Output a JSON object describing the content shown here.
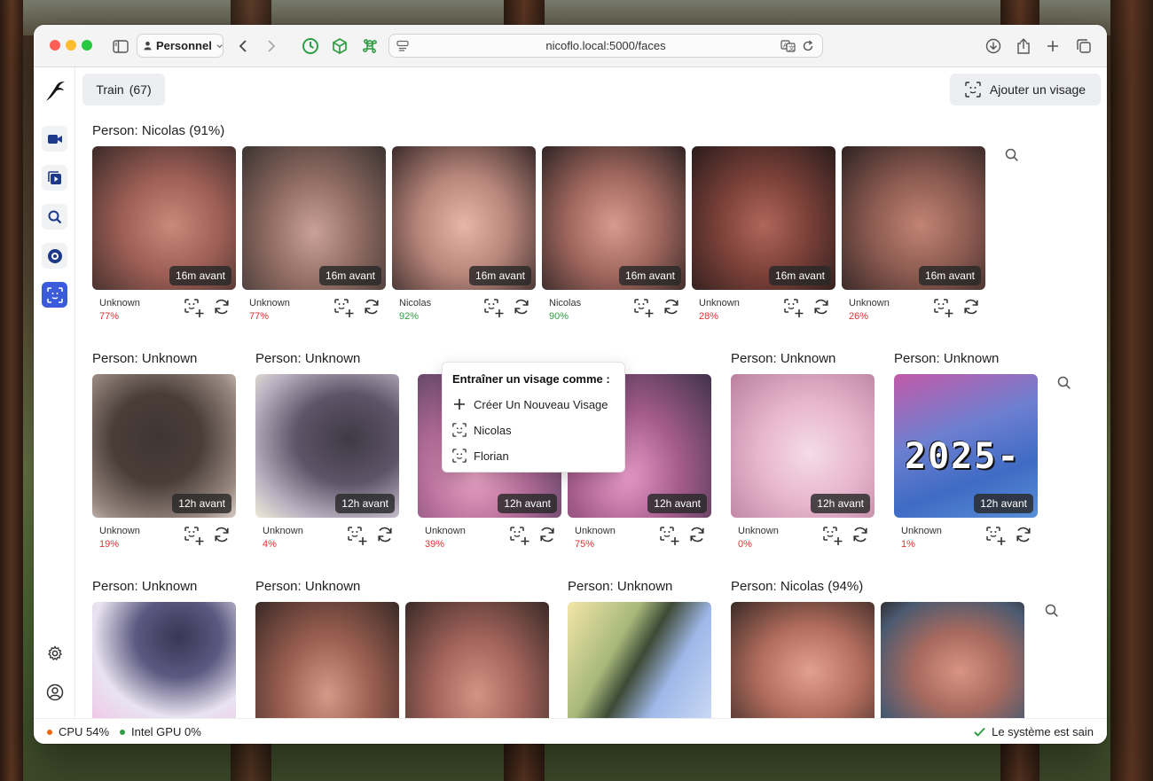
{
  "colors": {
    "accent": "#3b5bdb",
    "unknown_red": "#e03131",
    "known_green": "#2f9e44",
    "cpu_dot": "#f76707",
    "gpu_dot": "#2f9e44"
  },
  "browser": {
    "profile": "Personnel",
    "url": "nicoflo.local:5000/faces"
  },
  "sidebar": {
    "items": [
      {
        "name": "camera-icon"
      },
      {
        "name": "playback-icon"
      },
      {
        "name": "search-icon"
      },
      {
        "name": "target-icon"
      },
      {
        "name": "face-scan-icon"
      }
    ],
    "bottom": [
      {
        "name": "gear-icon"
      },
      {
        "name": "user-icon"
      }
    ]
  },
  "toolbar": {
    "train_label": "Train",
    "train_count": "(67)",
    "add_face_label": "Ajouter un visage"
  },
  "groups": [
    {
      "title": "Person: Nicolas (91%)"
    },
    {
      "title": "Person: Unknown"
    },
    {
      "title": "Person: Unknown"
    },
    {
      "title": "Person: Unknown"
    },
    {
      "title": "Person: Unknown"
    },
    {
      "title": "Person: Unknown"
    },
    {
      "title": "Person: Unknown"
    },
    {
      "title": "Person: Unknown"
    },
    {
      "title": "Person: Unknown"
    },
    {
      "title": "Person: Nicolas (94%)"
    }
  ],
  "faces_row1": [
    {
      "ago": "16m avant",
      "name": "Unknown",
      "pct": "77%"
    },
    {
      "ago": "16m avant",
      "name": "Unknown",
      "pct": "77%"
    },
    {
      "ago": "16m avant",
      "name": "Nicolas",
      "pct": "92%"
    },
    {
      "ago": "16m avant",
      "name": "Nicolas",
      "pct": "90%"
    },
    {
      "ago": "16m avant",
      "name": "Unknown",
      "pct": "28%"
    },
    {
      "ago": "16m avant",
      "name": "Unknown",
      "pct": "26%"
    }
  ],
  "faces_row2": [
    {
      "ago": "12h avant",
      "name": "Unknown",
      "pct": "19%"
    },
    {
      "ago": "12h avant",
      "name": "Unknown",
      "pct": "4%"
    },
    {
      "ago": "12h avant",
      "name": "Unknown",
      "pct": "39%"
    },
    {
      "ago": "12h avant",
      "name": "Unknown",
      "pct": "75%"
    },
    {
      "ago": "12h avant",
      "name": "Unknown",
      "pct": "0%"
    },
    {
      "ago": "12h avant",
      "name": "Unknown",
      "pct": "1%"
    }
  ],
  "face_overlay_text": "2025-",
  "popup": {
    "title": "Entraîner un visage comme :",
    "options": [
      "Créer Un Nouveau Visage",
      "Nicolas",
      "Florian"
    ]
  },
  "status": {
    "cpu": "CPU 54%",
    "gpu": "Intel GPU 0%",
    "health": "Le système est sain"
  }
}
